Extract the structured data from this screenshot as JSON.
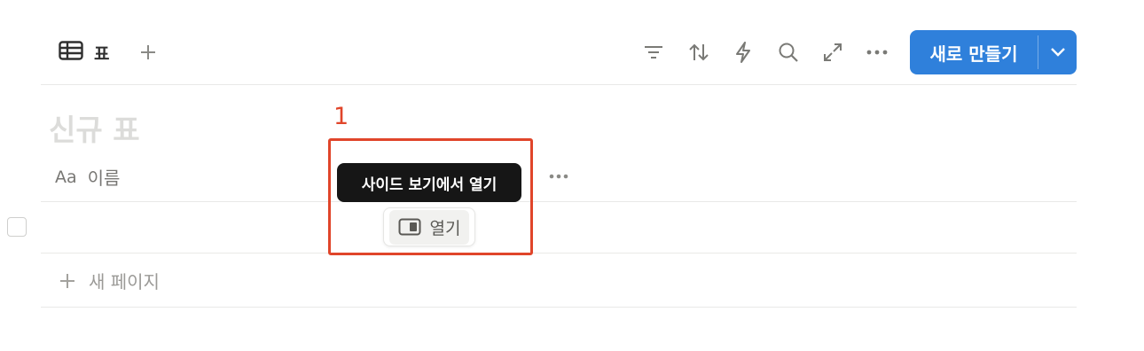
{
  "view": {
    "tab_label": "표",
    "tab_icon": "table-icon"
  },
  "toolbar": {
    "icons": [
      "filter-icon",
      "sort-icon",
      "automation-icon",
      "search-icon",
      "expand-icon",
      "more-icon"
    ],
    "new_button_label": "새로 만들기"
  },
  "database": {
    "title": "신규 표",
    "property_type_label": "Aa",
    "property_name": "이름",
    "new_page_label": "새 페이지"
  },
  "tooltip": {
    "text": "사이드 보기에서 열기"
  },
  "open_button": {
    "label": "열기"
  },
  "annotation": {
    "number": "1",
    "color": "#e0452a"
  },
  "colors": {
    "accent": "#2f80db",
    "tooltip_bg": "#161616",
    "divider": "#e9e9e7"
  }
}
